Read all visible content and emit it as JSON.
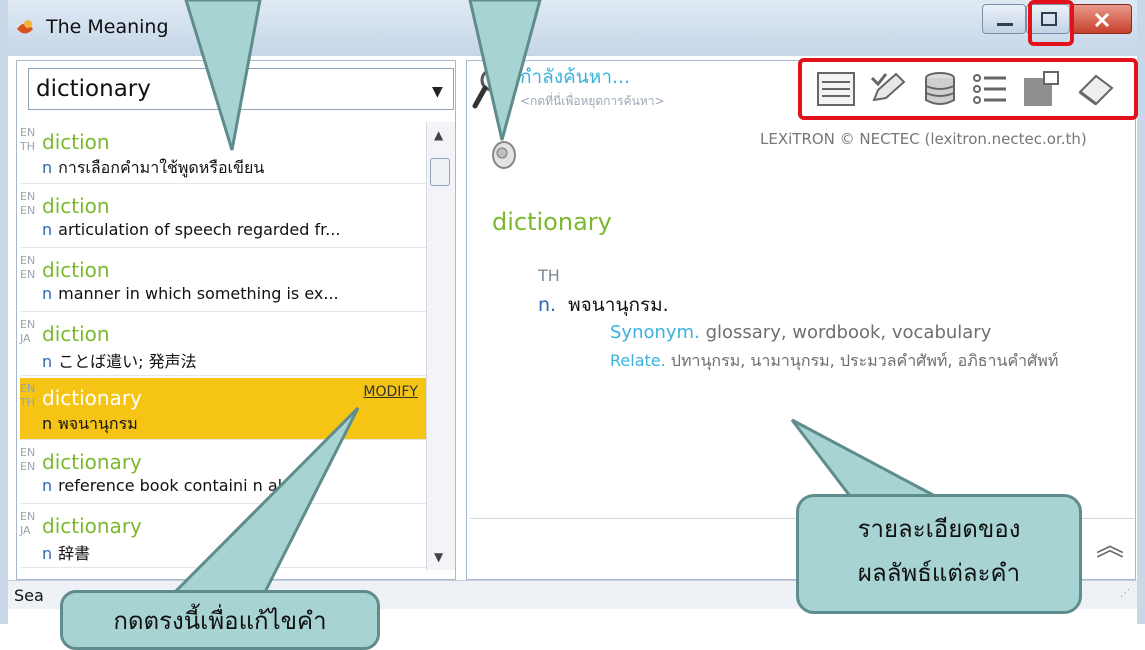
{
  "window": {
    "title": "The Meaning"
  },
  "search": {
    "value": "dictionary"
  },
  "results": [
    {
      "l1": "EN",
      "l2": "TH",
      "word": "diction",
      "pos": "n",
      "def": "การเลือกคำมาใช้พูดหรือเขียน",
      "selected": false
    },
    {
      "l1": "EN",
      "l2": "EN",
      "word": "diction",
      "pos": "n",
      "def": "articulation of speech regarded fr...",
      "selected": false
    },
    {
      "l1": "EN",
      "l2": "EN",
      "word": "diction",
      "pos": "n",
      "def": "manner in which something is ex...",
      "selected": false
    },
    {
      "l1": "EN",
      "l2": "JA",
      "word": "diction",
      "pos": "n",
      "def": "ことば遣い; 発声法",
      "selected": false
    },
    {
      "l1": "EN",
      "l2": "TH",
      "word": "dictionary",
      "pos": "n",
      "def": "พจนานุกรม",
      "selected": true,
      "modify": "MODIFY"
    },
    {
      "l1": "EN",
      "l2": "EN",
      "word": "dictionary",
      "pos": "n",
      "def": "reference book containi     n alp...",
      "selected": false
    },
    {
      "l1": "EN",
      "l2": "JA",
      "word": "dictionary",
      "pos": "n",
      "def": "辞書",
      "selected": false
    }
  ],
  "status": {
    "text": "Sea"
  },
  "header": {
    "searching": "กำลังค้นหา...",
    "stop_hint": "<กดที่นี่เพื่อหยุดการค้นหา>"
  },
  "toolbar": [
    "list-view-icon",
    "edit-icon",
    "database-icon",
    "bullet-list-icon",
    "window-icon",
    "eraser-icon"
  ],
  "detail": {
    "copyright": "LEXiTRON © NECTEC (lexitron.nectec.or.th)",
    "word": "dictionary",
    "lang": "TH",
    "pos": "n.",
    "meaning": "พจนานุกรม.",
    "synonym_label": "Synonym.",
    "synonym_text": "glossary, wordbook, vocabulary",
    "relate_label": "Relate.",
    "relate_text": "ปทานุกรม, นามานุกรม, ประมวลคำศัพท์, อภิธานคำศัพท์"
  },
  "callouts": {
    "modify": "กดตรงนี้เพื่อแก้ไขคำ",
    "details_line1": "รายละเอียดของ",
    "details_line2": "ผลลัพธ์แต่ละคำ"
  },
  "colors": {
    "highlight": "#f5c414",
    "word_green": "#7cb82f",
    "link_blue": "#39b2de",
    "callout": "#a8d3d3",
    "annotation_red": "#e1121b"
  }
}
